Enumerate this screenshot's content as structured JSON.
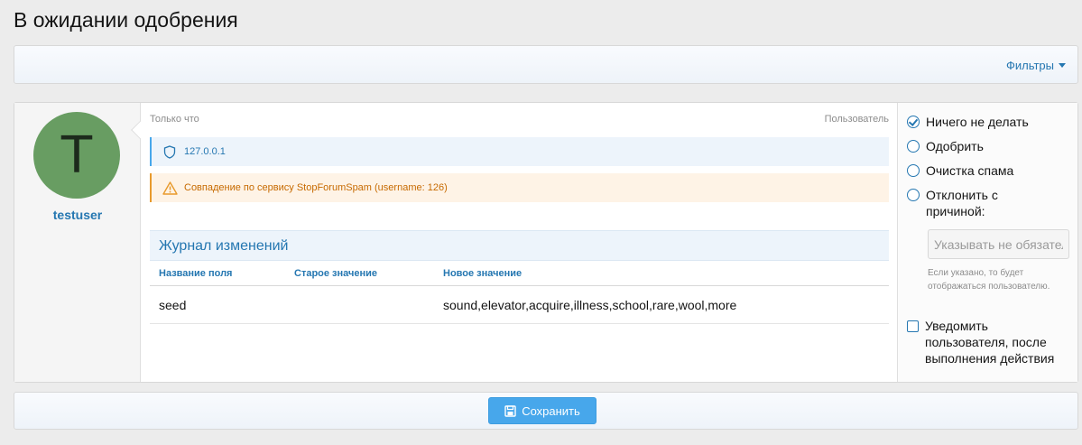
{
  "page": {
    "title": "В ожидании одобрения"
  },
  "filters": {
    "label": "Фильтры"
  },
  "entry": {
    "username": "testuser",
    "avatar_letter": "T",
    "time": "Только что",
    "type": "Пользователь",
    "ip": "127.0.0.1",
    "warning": "Совпадение по сервису StopForumSpam (username: 126)"
  },
  "change_log": {
    "title": "Журнал изменений",
    "headers": [
      "Название поля",
      "Старое значение",
      "Новое значение"
    ],
    "rows": [
      {
        "field": "seed",
        "old": "",
        "new": "sound,elevator,acquire,illness,school,rare,wool,more"
      }
    ]
  },
  "actions": {
    "options": [
      "Ничего не делать",
      "Одобрить",
      "Очистка спама",
      "Отклонить с причиной:"
    ],
    "selected": "Ничего не делать",
    "reason_placeholder": "Указывать не обязательно",
    "reason_hint": "Если указано, то будет отображаться пользователю.",
    "notify_label": "Уведомить пользователя, после выполнения действия"
  },
  "footer": {
    "save_label": "Сохранить"
  },
  "colors": {
    "accent": "#2577b1",
    "button": "#47a7eb",
    "warning": "#c76a00",
    "avatar_bg": "#689d62"
  }
}
